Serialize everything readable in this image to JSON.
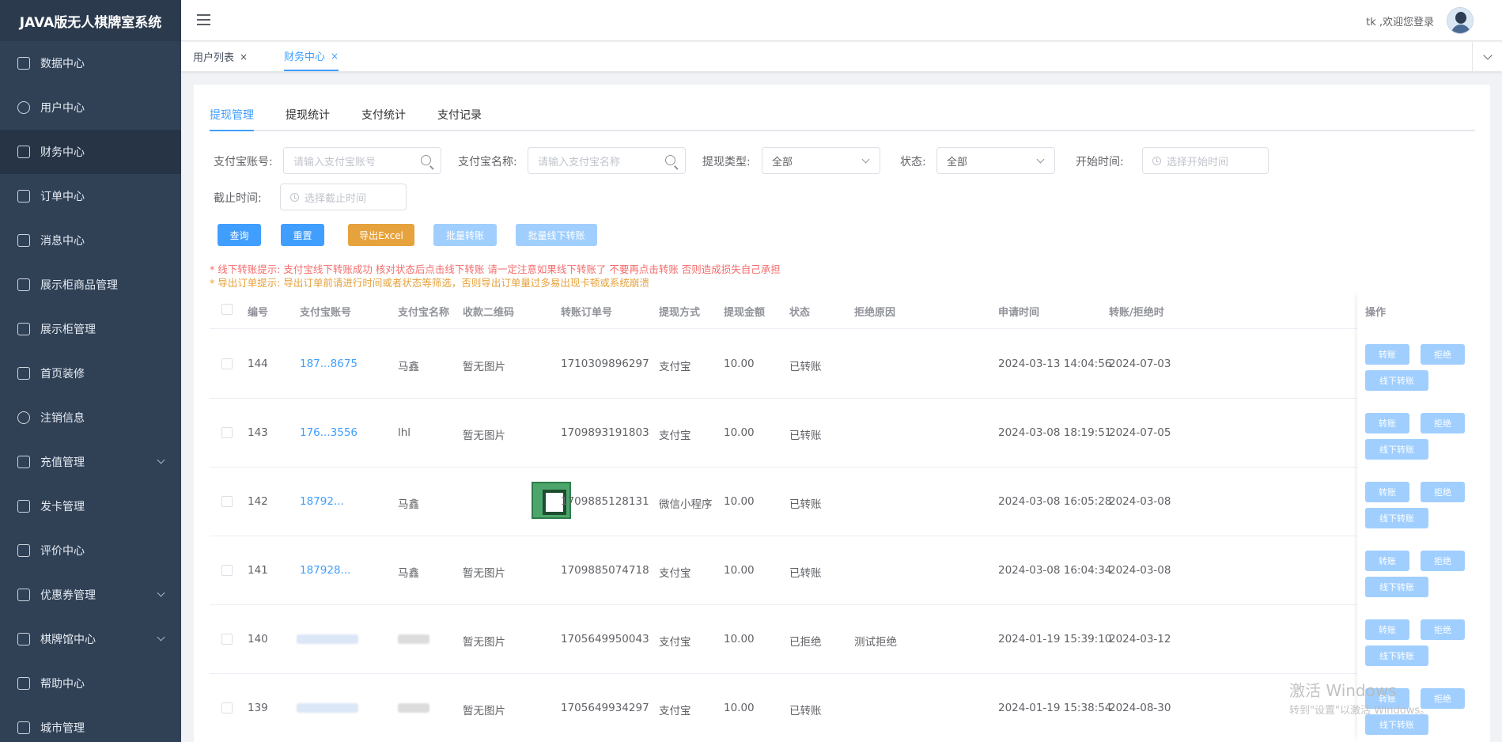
{
  "app": {
    "title": "JAVA版无人棋牌室系统"
  },
  "sidebar": {
    "items": [
      {
        "label": "数据中心",
        "icon": "chart-icon",
        "active": false,
        "expandable": false
      },
      {
        "label": "用户中心",
        "icon": "user-icon",
        "active": false,
        "expandable": false
      },
      {
        "label": "财务中心",
        "icon": "wallet-icon",
        "active": true,
        "expandable": false
      },
      {
        "label": "订单中心",
        "icon": "document-icon",
        "active": false,
        "expandable": false
      },
      {
        "label": "消息中心",
        "icon": "message-icon",
        "active": false,
        "expandable": false
      },
      {
        "label": "展示柜商品管理",
        "icon": "box-icon",
        "active": false,
        "expandable": false
      },
      {
        "label": "展示柜管理",
        "icon": "list-icon",
        "active": false,
        "expandable": false
      },
      {
        "label": "首页装修",
        "icon": "cube-icon",
        "active": false,
        "expandable": false
      },
      {
        "label": "注销信息",
        "icon": "pie-icon",
        "active": false,
        "expandable": false
      },
      {
        "label": "充值管理",
        "icon": "recharge-icon",
        "active": false,
        "expandable": true
      },
      {
        "label": "发卡管理",
        "icon": "chart-icon",
        "active": false,
        "expandable": false
      },
      {
        "label": "评价中心",
        "icon": "message-icon",
        "active": false,
        "expandable": false
      },
      {
        "label": "优惠券管理",
        "icon": "chart-icon",
        "active": false,
        "expandable": true
      },
      {
        "label": "棋牌馆中心",
        "icon": "monitor-icon",
        "active": false,
        "expandable": true
      },
      {
        "label": "帮助中心",
        "icon": "chart-icon",
        "active": false,
        "expandable": false
      },
      {
        "label": "城市管理",
        "icon": "chart-icon",
        "active": false,
        "expandable": false
      }
    ]
  },
  "header": {
    "welcome": "tk ,欢迎您登录"
  },
  "tags": [
    {
      "label": "用户列表",
      "close": "×",
      "active": false
    },
    {
      "label": "财务中心",
      "close": "×",
      "active": true
    }
  ],
  "subtabs": [
    {
      "label": "提现管理",
      "active": true
    },
    {
      "label": "提现统计",
      "active": false
    },
    {
      "label": "支付统计",
      "active": false
    },
    {
      "label": "支付记录",
      "active": false
    }
  ],
  "filters": {
    "alipay_account": {
      "label": "支付宝账号:",
      "placeholder": "请输入支付宝账号"
    },
    "alipay_name": {
      "label": "支付宝名称:",
      "placeholder": "请输入支付宝名称"
    },
    "withdraw_type": {
      "label": "提现类型:",
      "value": "全部"
    },
    "status": {
      "label": "状态:",
      "value": "全部"
    },
    "start_time": {
      "label": "开始时间:",
      "placeholder": "选择开始时间"
    },
    "end_time": {
      "label": "截止时间:",
      "placeholder": "选择截止时间"
    }
  },
  "buttons": {
    "query": "查询",
    "reset": "重置",
    "export": "导出Excel",
    "batch_transfer": "批量转账",
    "batch_offline": "批量线下转账"
  },
  "tips": {
    "offline": "* 线下转账提示:  支付宝线下转账成功 核对状态后点击线下转账 请一定注意如果线下转账了 不要再点击转账 否则造成损失自己承担",
    "export": "* 导出订单提示:  导出订单前请进行时间或者状态等筛选，否则导出订单量过多易出现卡顿或系统崩溃"
  },
  "table": {
    "columns": [
      "编号",
      "支付宝账号",
      "支付宝名称",
      "收款二维码",
      "转账订单号",
      "提现方式",
      "提现金额",
      "状态",
      "拒绝原因",
      "申请时间",
      "转账/拒绝时",
      "操作"
    ],
    "rows": [
      {
        "id": "144",
        "account": "187...8675",
        "name": "马鑫",
        "qr": "暂无图片",
        "order_no": "1710309896297",
        "method": "支付宝",
        "amount": "10.00",
        "status": "已转账",
        "reason": "",
        "apply_time": "2024-03-13 14:04:56",
        "done_time": "2024-07-03"
      },
      {
        "id": "143",
        "account": "176...3556",
        "name": "lhl",
        "qr": "暂无图片",
        "order_no": "1709893191803",
        "method": "支付宝",
        "amount": "10.00",
        "status": "已转账",
        "reason": "",
        "apply_time": "2024-03-08 18:19:51",
        "done_time": "2024-07-05"
      },
      {
        "id": "142",
        "account": "18792...",
        "name": "马鑫",
        "qr": "",
        "order_no": "1709885128131",
        "method": "微信小程序",
        "amount": "10.00",
        "status": "已转账",
        "reason": "",
        "apply_time": "2024-03-08 16:05:28",
        "done_time": "2024-03-08"
      },
      {
        "id": "141",
        "account": "187928...",
        "name": "马鑫",
        "qr": "暂无图片",
        "order_no": "1709885074718",
        "method": "支付宝",
        "amount": "10.00",
        "status": "已转账",
        "reason": "",
        "apply_time": "2024-03-08 16:04:34",
        "done_time": "2024-03-08"
      },
      {
        "id": "140",
        "account": "",
        "name": "",
        "qr": "暂无图片",
        "order_no": "1705649950043",
        "method": "支付宝",
        "amount": "10.00",
        "status": "已拒绝",
        "reason": "测试拒绝",
        "apply_time": "2024-01-19 15:39:10",
        "done_time": "2024-03-12"
      },
      {
        "id": "139",
        "account": "",
        "name": "",
        "qr": "暂无图片",
        "order_no": "1705649934297",
        "method": "支付宝",
        "amount": "10.00",
        "status": "已转账",
        "reason": "",
        "apply_time": "2024-01-19 15:38:54",
        "done_time": "2024-08-30"
      }
    ],
    "ops": {
      "transfer": "转账",
      "reject": "拒绝",
      "offline": "线下转账"
    }
  },
  "watermark": {
    "line1": "激活 Windows",
    "line2": "转到\"设置\"以激活 Windows。"
  },
  "colors": {
    "primary": "#409eff",
    "warning": "#e6a23c",
    "danger": "#f56c6c",
    "sidebar": "#304156"
  }
}
